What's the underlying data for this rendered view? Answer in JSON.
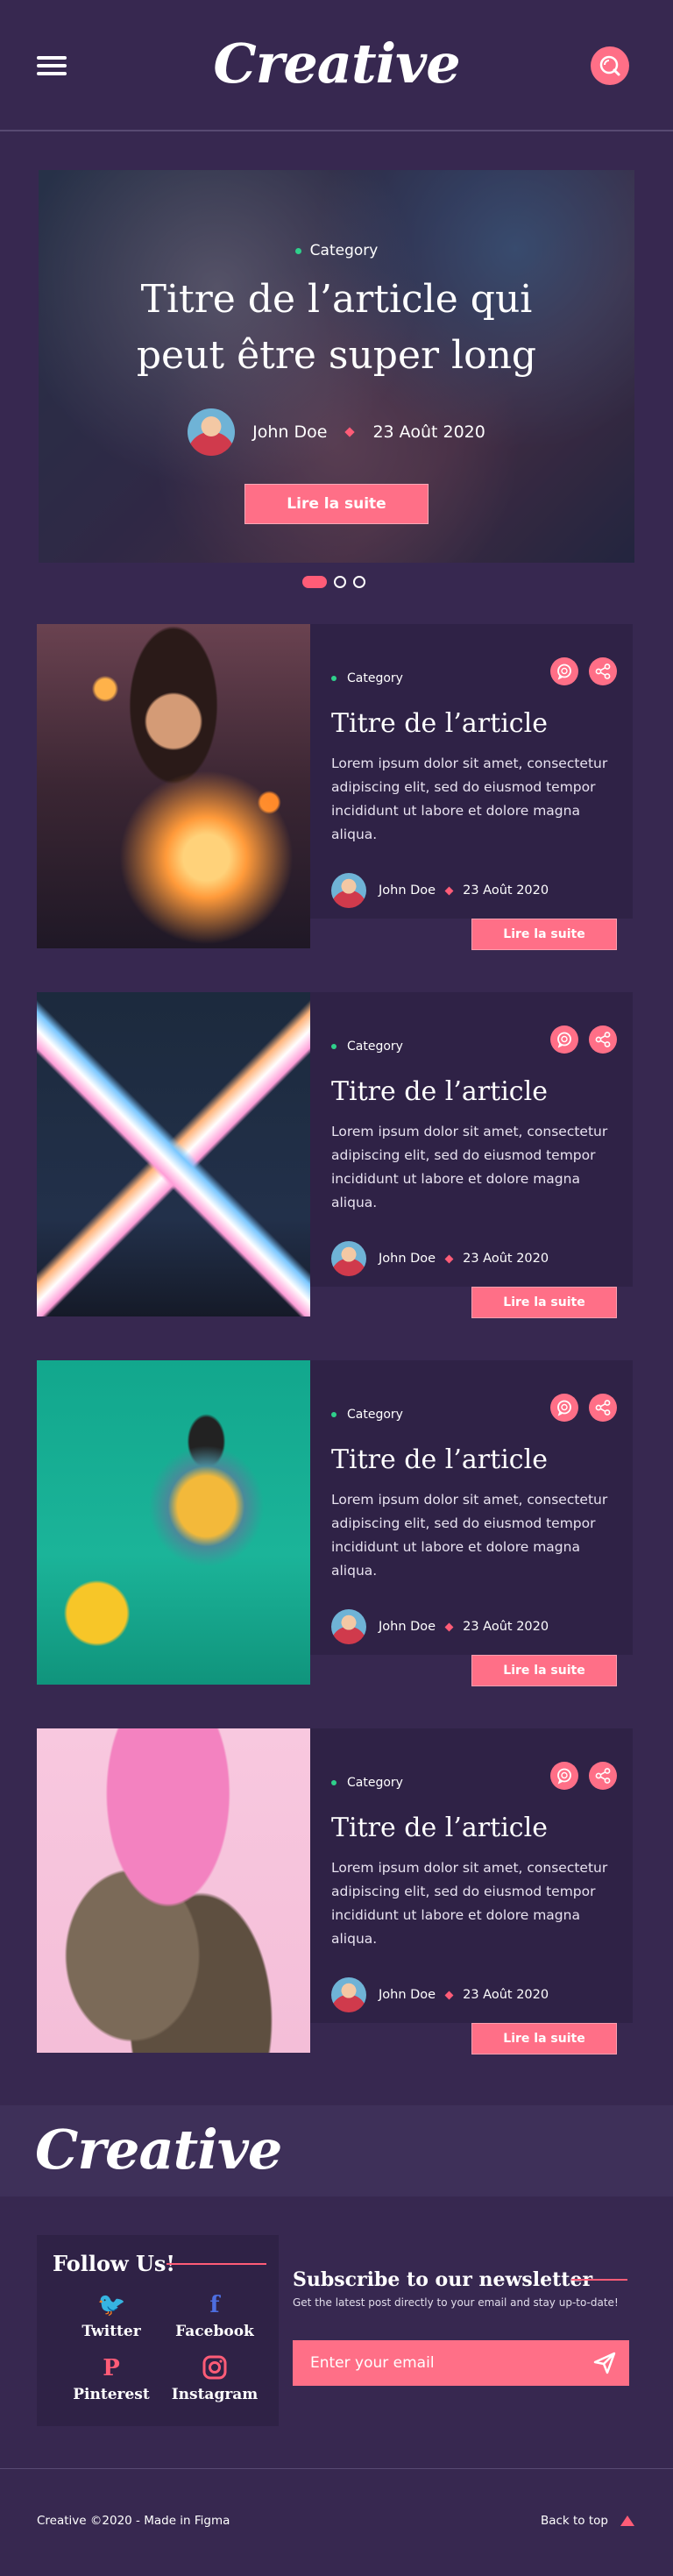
{
  "header": {
    "logo": "Creative",
    "menu_icon": "hamburger-menu-icon",
    "search_icon": "search-icon"
  },
  "hero": {
    "category": "Category",
    "title": "Titre de l’article qui peut être super long",
    "author": "John Doe",
    "date": "23 Août 2020",
    "button": "Lire la suite",
    "slides": 3,
    "active_slide": 1
  },
  "articles": [
    {
      "category": "Category",
      "title": "Titre de l’article",
      "excerpt": "Lorem ipsum dolor sit amet, consectetur adipiscing elit, sed do eiusmod tempor incididunt ut labore et dolore magna aliqua.",
      "author": "John Doe",
      "date": "23 Août 2020",
      "button": "Lire la suite",
      "image": "woman-holding-lights"
    },
    {
      "category": "Category",
      "title": "Titre de l’article",
      "excerpt": "Lorem ipsum dolor sit amet, consectetur adipiscing elit, sed do eiusmod tempor incididunt ut labore et dolore magna aliqua.",
      "author": "John Doe",
      "date": "23 Août 2020",
      "button": "Lire la suite",
      "image": "neon-x-sign"
    },
    {
      "category": "Category",
      "title": "Titre de l’article",
      "excerpt": "Lorem ipsum dolor sit amet, consectetur adipiscing elit, sed do eiusmod tempor incididunt ut labore et dolore magna aliqua.",
      "author": "John Doe",
      "date": "23 Août 2020",
      "button": "Lire la suite",
      "image": "woman-with-pikachu"
    },
    {
      "category": "Category",
      "title": "Titre de l’article",
      "excerpt": "Lorem ipsum dolor sit amet, consectetur adipiscing elit, sed do eiusmod tempor incididunt ut labore et dolore magna aliqua.",
      "author": "John Doe",
      "date": "23 Août 2020",
      "button": "Lire la suite",
      "image": "cat-with-pink-hat"
    }
  ],
  "footer": {
    "logo": "Creative",
    "follow_title": "Follow Us!",
    "socials": [
      {
        "label": "Twitter",
        "icon": "twitter-icon",
        "color": "#4fb0ec"
      },
      {
        "label": "Facebook",
        "icon": "facebook-icon",
        "color": "#4d6ee0"
      },
      {
        "label": "Pinterest",
        "icon": "pinterest-icon",
        "color": "#ff5c77"
      },
      {
        "label": "Instagram",
        "icon": "instagram-icon",
        "color": "#ff5c77"
      }
    ],
    "newsletter_title": "Subscribe to our newsletter",
    "newsletter_sub": "Get the latest post directly to your email and stay up-to-date!",
    "email_placeholder": "Enter your email",
    "copyright": "Creative ©2020 - Made in Figma",
    "back_to_top": "Back to top"
  },
  "colors": {
    "background": "#372850",
    "accent": "#ff6f87",
    "card": "#2f2246",
    "category_dot": "#2fd08b"
  }
}
